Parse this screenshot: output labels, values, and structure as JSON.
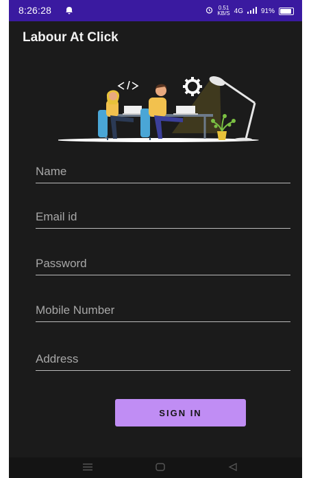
{
  "status_bar": {
    "time": "8:26:28",
    "speed": "0.51",
    "speed_unit": "KB/S",
    "network": "4G",
    "battery": "91%",
    "battery_level": 0.91
  },
  "app": {
    "title": "Labour At Click"
  },
  "form": {
    "name_placeholder": "Name",
    "email_placeholder": "Email id",
    "password_placeholder": "Password",
    "mobile_placeholder": "Mobile Number",
    "address_placeholder": "Address",
    "signin_label": "SIGN IN"
  },
  "nav": {
    "menu_icon": "menu-icon",
    "home_icon": "home-icon",
    "back_icon": "back-icon"
  },
  "colors": {
    "status_bar": "#3a1aa0",
    "background": "#1b1b1b",
    "button": "#c08df4"
  }
}
